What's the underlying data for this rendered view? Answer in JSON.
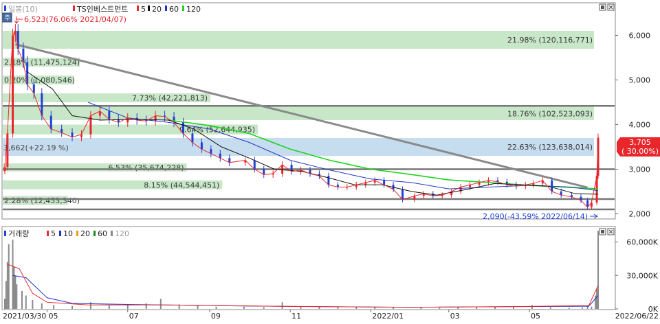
{
  "price_panel": {
    "legend": {
      "label_a": "일봉(10)",
      "label_b": "TS인베스트먼트",
      "ma": [
        "5",
        "20",
        "60",
        "120"
      ]
    },
    "high_label": "6,523(76.06% 2021/04/07)",
    "low_label": "2,090(-43.59% 2022/06/14)",
    "left_marker": "3,662(+22.19 %)",
    "last_price": "3,705",
    "last_change": "( 30.00%)",
    "y_ticks": [
      "6,000",
      "5,000",
      "4,000",
      "3,000",
      "2,000"
    ],
    "colors": {
      "up": "#e8262b",
      "down": "#1f3fd6",
      "ma5": "#e82a2a",
      "ma20": "#111111",
      "ma60": "#2035c8",
      "ma120": "#1cd41c",
      "zone_green": "#c8e6c8",
      "zone_blue": "#c6dcef",
      "trend": "#8a8a8a",
      "hline": "#777777"
    },
    "zones": [
      {
        "from": 5700,
        "to": 6100,
        "label": "21.98% (120,116,771)",
        "color": "green",
        "align": "right"
      },
      {
        "from": 4100,
        "to": 4400,
        "label": "18.76% (102,523,093)",
        "color": "green",
        "align": "right"
      },
      {
        "from": 3300,
        "to": 3700,
        "label": "22.63% (123,638,014)",
        "color": "blue",
        "align": "right"
      },
      {
        "from": 5300,
        "to": 5500,
        "label": "2.18% (11,475,124)",
        "color": "green",
        "align": "left",
        "width": 0.13
      },
      {
        "from": 4900,
        "to": 5100,
        "label": "0.20% (1,080,546)",
        "color": "green",
        "align": "left",
        "width": 0.12
      },
      {
        "from": 4500,
        "to": 4700,
        "label": "7.73% (42,221,813)",
        "color": "green",
        "align": "left",
        "width": 0.35
      },
      {
        "from": 3780,
        "to": 4000,
        "label": "9.64% (52,644,935)",
        "color": "green",
        "align": "left",
        "width": 0.43
      },
      {
        "from": 2950,
        "to": 3130,
        "label": "6.53% (35,674,228)",
        "color": "green",
        "align": "left",
        "width": 0.31
      },
      {
        "from": 2550,
        "to": 2750,
        "label": "8.15% (44,544,451)",
        "color": "green",
        "align": "left",
        "width": 0.37
      },
      {
        "from": 2200,
        "to": 2400,
        "label": "2.28% (12,453,340)",
        "color": "green",
        "align": "left",
        "width": 0.11
      }
    ],
    "h_lines": [
      4420,
      3000,
      2330,
      2100
    ],
    "trendline": {
      "from": [
        "2021/04/07",
        5800
      ],
      "to": [
        "2022/06/14",
        2590
      ]
    }
  },
  "volume_panel": {
    "legend": {
      "label": "거래량",
      "ma": [
        "5",
        "10",
        "20",
        "60",
        "120"
      ]
    },
    "y_ticks": [
      "60,000K",
      "30,000K",
      "0K"
    ],
    "colors": {
      "ma5": "#e82a2a",
      "ma10": "#2035c8",
      "ma20": "#e89a1a",
      "ma60": "#1a8a1a",
      "ma120": "#888888",
      "bar": "#8a8a8a"
    }
  },
  "x_axis": {
    "labels": [
      "2021/03/30",
      "05",
      "07",
      "09",
      "11",
      "2022/01",
      "03",
      "05",
      "2022/06/22"
    ]
  },
  "chart_data": {
    "type": "candlestick",
    "x_range": [
      "2021/03/30",
      "2022/06/22"
    ],
    "ylim": [
      1900,
      6700
    ],
    "volume_ylim": [
      0,
      72000
    ],
    "volume_unit": "K",
    "close": [
      [
        "2021/03/30",
        3050
      ],
      [
        "2021/04/01",
        3800
      ],
      [
        "2021/04/05",
        6000
      ],
      [
        "2021/04/07",
        6100
      ],
      [
        "2021/04/09",
        5700
      ],
      [
        "2021/04/13",
        5400
      ],
      [
        "2021/04/16",
        4900
      ],
      [
        "2021/04/21",
        4700
      ],
      [
        "2021/04/27",
        4200
      ],
      [
        "2021/05/04",
        3900
      ],
      [
        "2021/05/12",
        3820
      ],
      [
        "2021/05/20",
        3720
      ],
      [
        "2021/05/27",
        3780
      ],
      [
        "2021/06/03",
        4200
      ],
      [
        "2021/06/10",
        4300
      ],
      [
        "2021/06/17",
        4120
      ],
      [
        "2021/06/24",
        4050
      ],
      [
        "2021/07/01",
        4150
      ],
      [
        "2021/07/08",
        4100
      ],
      [
        "2021/07/15",
        4080
      ],
      [
        "2021/07/22",
        4200
      ],
      [
        "2021/07/29",
        4180
      ],
      [
        "2021/08/05",
        4050
      ],
      [
        "2021/08/12",
        3800
      ],
      [
        "2021/08/19",
        3600
      ],
      [
        "2021/08/26",
        3450
      ],
      [
        "2021/09/02",
        3350
      ],
      [
        "2021/09/09",
        3250
      ],
      [
        "2021/09/16",
        3150
      ],
      [
        "2021/09/28",
        3200
      ],
      [
        "2021/10/05",
        3000
      ],
      [
        "2021/10/12",
        2880
      ],
      [
        "2021/10/19",
        2900
      ],
      [
        "2021/10/26",
        3100
      ],
      [
        "2021/11/02",
        2950
      ],
      [
        "2021/11/09",
        2980
      ],
      [
        "2021/11/16",
        2900
      ],
      [
        "2021/11/23",
        2850
      ],
      [
        "2021/11/30",
        2650
      ],
      [
        "2021/12/07",
        2600
      ],
      [
        "2021/12/14",
        2600
      ],
      [
        "2021/12/21",
        2650
      ],
      [
        "2021/12/28",
        2700
      ],
      [
        "2022/01/04",
        2750
      ],
      [
        "2022/01/11",
        2650
      ],
      [
        "2022/01/18",
        2550
      ],
      [
        "2022/01/25",
        2320
      ],
      [
        "2022/02/03",
        2400
      ],
      [
        "2022/02/10",
        2450
      ],
      [
        "2022/02/17",
        2400
      ],
      [
        "2022/02/24",
        2420
      ],
      [
        "2022/03/03",
        2500
      ],
      [
        "2022/03/10",
        2600
      ],
      [
        "2022/03/17",
        2650
      ],
      [
        "2022/03/24",
        2700
      ],
      [
        "2022/03/31",
        2750
      ],
      [
        "2022/04/07",
        2720
      ],
      [
        "2022/04/14",
        2650
      ],
      [
        "2022/04/21",
        2620
      ],
      [
        "2022/04/28",
        2650
      ],
      [
        "2022/05/04",
        2680
      ],
      [
        "2022/05/11",
        2750
      ],
      [
        "2022/05/18",
        2500
      ],
      [
        "2022/05/25",
        2420
      ],
      [
        "2022/06/02",
        2380
      ],
      [
        "2022/06/09",
        2300
      ],
      [
        "2022/06/14",
        2150
      ],
      [
        "2022/06/17",
        2250
      ],
      [
        "2022/06/21",
        2850
      ],
      [
        "2022/06/22",
        3705
      ]
    ],
    "ma20": [
      [
        "2021/04/15",
        5200
      ],
      [
        "2021/05/05",
        4800
      ],
      [
        "2021/05/20",
        4200
      ],
      [
        "2021/06/10",
        4100
      ],
      [
        "2021/07/05",
        4120
      ],
      [
        "2021/08/01",
        4100
      ],
      [
        "2021/08/20",
        3900
      ],
      [
        "2021/09/10",
        3500
      ],
      [
        "2021/10/01",
        3250
      ],
      [
        "2021/10/20",
        3000
      ],
      [
        "2021/11/10",
        2950
      ],
      [
        "2021/12/01",
        2800
      ],
      [
        "2021/12/20",
        2650
      ],
      [
        "2022/01/10",
        2650
      ],
      [
        "2022/02/01",
        2500
      ],
      [
        "2022/02/20",
        2420
      ],
      [
        "2022/03/15",
        2550
      ],
      [
        "2022/04/05",
        2680
      ],
      [
        "2022/04/25",
        2650
      ],
      [
        "2022/05/15",
        2620
      ],
      [
        "2022/06/05",
        2450
      ],
      [
        "2022/06/22",
        2440
      ]
    ],
    "ma60": [
      [
        "2021/06/01",
        4500
      ],
      [
        "2021/07/01",
        4150
      ],
      [
        "2021/08/01",
        4050
      ],
      [
        "2021/09/01",
        3900
      ],
      [
        "2021/10/01",
        3600
      ],
      [
        "2021/11/01",
        3200
      ],
      [
        "2021/12/01",
        2980
      ],
      [
        "2022/01/01",
        2780
      ],
      [
        "2022/02/01",
        2700
      ],
      [
        "2022/03/01",
        2560
      ],
      [
        "2022/04/01",
        2600
      ],
      [
        "2022/05/01",
        2640
      ],
      [
        "2022/06/01",
        2600
      ],
      [
        "2022/06/22",
        2520
      ]
    ],
    "ma120": [
      [
        "2021/08/01",
        4100
      ],
      [
        "2021/09/01",
        3980
      ],
      [
        "2021/10/01",
        3800
      ],
      [
        "2021/11/01",
        3450
      ],
      [
        "2021/12/01",
        3200
      ],
      [
        "2022/01/01",
        3000
      ],
      [
        "2022/02/01",
        2880
      ],
      [
        "2022/03/01",
        2760
      ],
      [
        "2022/04/01",
        2700
      ],
      [
        "2022/05/01",
        2640
      ],
      [
        "2022/06/01",
        2590
      ],
      [
        "2022/06/22",
        2560
      ]
    ],
    "volume": [
      [
        "2021/03/30",
        9000
      ],
      [
        "2021/03/31",
        25000
      ],
      [
        "2021/04/01",
        42000
      ],
      [
        "2021/04/02",
        58000
      ],
      [
        "2021/04/05",
        62000
      ],
      [
        "2021/04/06",
        38000
      ],
      [
        "2021/04/07",
        30000
      ],
      [
        "2021/04/08",
        22000
      ],
      [
        "2021/04/12",
        16000
      ],
      [
        "2021/04/15",
        12000
      ],
      [
        "2021/04/20",
        8000
      ],
      [
        "2021/04/27",
        5000
      ],
      [
        "2021/05/06",
        3500
      ],
      [
        "2021/05/20",
        2500
      ],
      [
        "2021/06/03",
        6000
      ],
      [
        "2021/06/17",
        3000
      ],
      [
        "2021/07/01",
        3500
      ],
      [
        "2021/07/15",
        5000
      ],
      [
        "2021/07/26",
        9000
      ],
      [
        "2021/08/09",
        4000
      ],
      [
        "2021/08/23",
        3000
      ],
      [
        "2021/09/06",
        2000
      ],
      [
        "2021/09/27",
        2000
      ],
      [
        "2021/10/12",
        1500
      ],
      [
        "2021/10/26",
        6000
      ],
      [
        "2021/11/09",
        2500
      ],
      [
        "2021/11/23",
        2000
      ],
      [
        "2021/12/07",
        1500
      ],
      [
        "2021/12/21",
        1500
      ],
      [
        "2022/01/04",
        2000
      ],
      [
        "2022/01/18",
        1500
      ],
      [
        "2022/02/08",
        1200
      ],
      [
        "2022/02/22",
        1000
      ],
      [
        "2022/03/08",
        1500
      ],
      [
        "2022/03/22",
        1800
      ],
      [
        "2022/04/05",
        2000
      ],
      [
        "2022/04/19",
        1500
      ],
      [
        "2022/05/03",
        3500
      ],
      [
        "2022/05/17",
        1500
      ],
      [
        "2022/05/31",
        1000
      ],
      [
        "2022/06/10",
        1200
      ],
      [
        "2022/06/14",
        3000
      ],
      [
        "2022/06/17",
        2000
      ],
      [
        "2022/06/20",
        12000
      ],
      [
        "2022/06/21",
        18000
      ],
      [
        "2022/06/22",
        70000
      ]
    ],
    "volume_ma5": [
      [
        "2021/04/01",
        40000
      ],
      [
        "2021/04/10",
        36000
      ],
      [
        "2021/04/20",
        14000
      ],
      [
        "2021/05/01",
        6000
      ],
      [
        "2021/06/01",
        3500
      ],
      [
        "2021/08/01",
        3500
      ],
      [
        "2021/11/01",
        2200
      ],
      [
        "2022/02/01",
        1400
      ],
      [
        "2022/05/01",
        2200
      ],
      [
        "2022/06/15",
        3000
      ],
      [
        "2022/06/22",
        21000
      ]
    ],
    "volume_ma10": [
      [
        "2021/04/05",
        30000
      ],
      [
        "2021/04/15",
        28000
      ],
      [
        "2021/05/01",
        10000
      ],
      [
        "2021/05/20",
        5000
      ],
      [
        "2021/07/01",
        4000
      ],
      [
        "2021/10/01",
        2500
      ],
      [
        "2022/02/01",
        1500
      ],
      [
        "2022/06/15",
        2400
      ],
      [
        "2022/06/22",
        12000
      ]
    ]
  }
}
